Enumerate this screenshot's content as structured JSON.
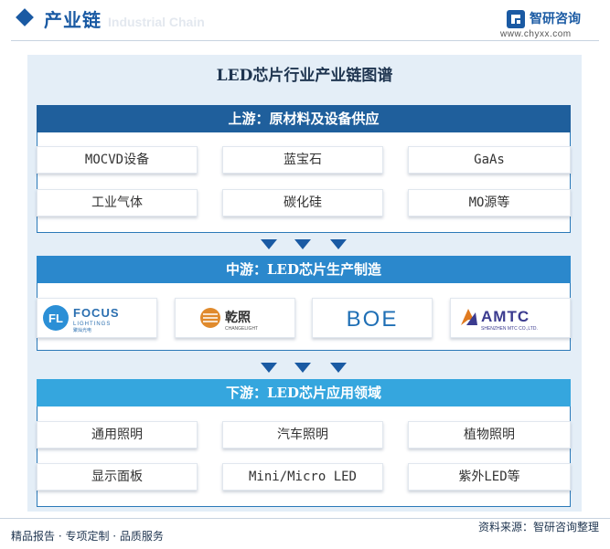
{
  "header": {
    "title": "产业链",
    "ghost_text": "Industrial Chain",
    "brand_name": "智研咨询",
    "brand_url": "www.chyxx.com"
  },
  "diagram": {
    "title": "LED芯片行业产业链图谱",
    "upstream": {
      "label": "上游：原材料及设备供应",
      "items": [
        "MOCVD设备",
        "蓝宝石",
        "GaAs",
        "工业气体",
        "碳化硅",
        "MO源等"
      ]
    },
    "midstream": {
      "label": "中游：LED芯片生产制造",
      "logos": [
        {
          "name": "FOCUS",
          "sub1": "LIGHTINGS",
          "sub2": "聚灿光电",
          "mark": "FL"
        },
        {
          "name": "乾照",
          "sub1": "CHANGELIGHT"
        },
        {
          "name": "BOE"
        },
        {
          "name": "AMTC",
          "sub1": "SHENZHEN MTC CO.,LTD."
        }
      ]
    },
    "downstream": {
      "label": "下游：LED芯片应用领域",
      "items": [
        "通用照明",
        "汽车照明",
        "植物照明",
        "显示面板",
        "Mini/Micro LED",
        "紫外LED等"
      ]
    }
  },
  "footer": {
    "left": "精品报告 · 专项定制 · 品质服务",
    "right": "资料来源：智研咨询整理"
  },
  "colors": {
    "upstream_bar": "#1f5f9c",
    "midstream_bar": "#2b88cc",
    "downstream_bar": "#35a6de",
    "arrow": "#1a5aa3",
    "panel_bg": "#e4eef7"
  }
}
